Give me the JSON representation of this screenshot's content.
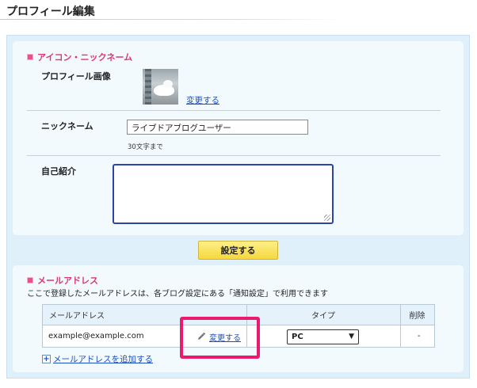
{
  "page": {
    "title": "プロフィール編集"
  },
  "profile_section": {
    "heading": "アイコン・ニックネーム",
    "image_label": "プロフィール画像",
    "change_link": "変更する",
    "nickname_label": "ニックネーム",
    "nickname_value": "ライブドアブログユーザー",
    "nickname_hint": "30文字まで",
    "bio_label": "自己紹介",
    "bio_value": ""
  },
  "submit_label": "設定する",
  "mail_section": {
    "heading": "メールアドレス",
    "description": "ここで登録したメールアドレスは、各ブログ設定にある「通知設定」で利用できます",
    "columns": [
      "メールアドレス",
      "タイプ",
      "削除"
    ],
    "rows": [
      {
        "email": "example@example.com",
        "change_label": "変更する",
        "type": "PC",
        "delete": "-"
      }
    ],
    "add_label": "メールアドレスを追加する"
  },
  "colors": {
    "accent_pink": "#e0336f",
    "highlight": "#e81b6f",
    "link": "#1a4fc2",
    "button_yellow": "#f6d73e"
  }
}
